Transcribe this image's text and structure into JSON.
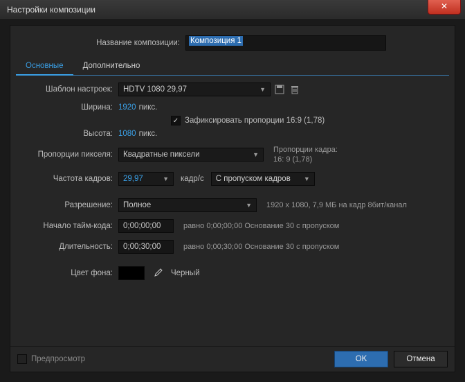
{
  "window": {
    "title": "Настройки композиции"
  },
  "composition": {
    "name_label": "Название композиции:",
    "name_value": "Композиция 1"
  },
  "tabs": {
    "basic": "Основные",
    "advanced": "Дополнительно"
  },
  "preset": {
    "label": "Шаблон настроек:",
    "value": "HDTV 1080 29,97"
  },
  "width": {
    "label": "Ширина:",
    "value": "1920",
    "unit": "пикс."
  },
  "height": {
    "label": "Высота:",
    "value": "1080",
    "unit": "пикс."
  },
  "lock_aspect": {
    "label": "Зафиксировать пропорции 16:9 (1,78)",
    "checked": true
  },
  "pixel_aspect": {
    "label": "Пропорции пикселя:",
    "value": "Квадратные пиксели",
    "frame_label": "Пропорции кадра:",
    "frame_value": "16: 9 (1,78)"
  },
  "framerate": {
    "label": "Частота кадров:",
    "value": "29,97",
    "unit": "кадр/с",
    "drop": "С пропуском кадров"
  },
  "resolution": {
    "label": "Разрешение:",
    "value": "Полное",
    "info": "1920 x 1080, 7,9 МБ на кадр 8бит/канал"
  },
  "timecode_start": {
    "label": "Начало тайм-кода:",
    "value": "0;00;00;00",
    "info": "равно 0;00;00;00  Основание 30  с пропуском"
  },
  "duration": {
    "label": "Длительность:",
    "value": "0;00;30;00",
    "info": "равно 0;00;30;00  Основание 30  с пропуском"
  },
  "bg": {
    "label": "Цвет фона:",
    "color": "#000000",
    "name": "Черный"
  },
  "footer": {
    "preview": "Предпросмотр",
    "ok": "OK",
    "cancel": "Отмена"
  }
}
